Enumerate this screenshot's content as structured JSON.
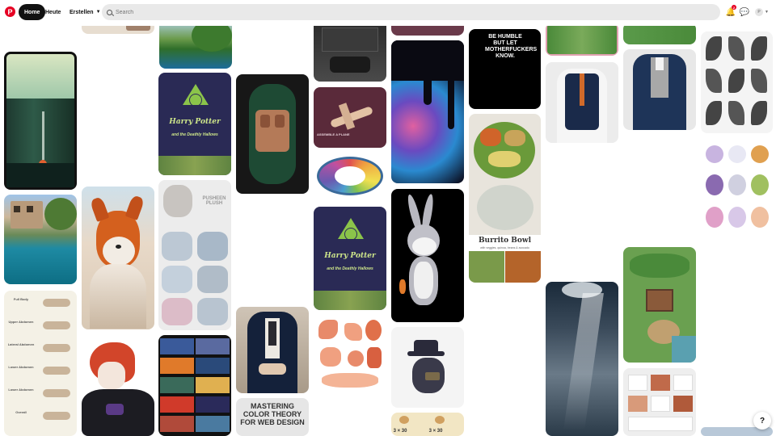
{
  "nav": {
    "logo": "P",
    "home": "Home",
    "today": "Heute",
    "create": "Erstellen"
  },
  "search": {
    "placeholder": "Search"
  },
  "header": {
    "notification_count": "2",
    "avatar_letter": "P"
  },
  "pins": {
    "hp_title_1": "Harry Potter",
    "hp_sub_1": "and the Deathly Hallows",
    "hp_title_2": "Harry Potter",
    "hp_sub_2": "and the Deathly Hallows",
    "pusheen": "PUSHEEN PLUSH",
    "behumble": "BE HUMBLE BUT LET MOTHERFUCKERS KNOW.",
    "burrito_title": "Burrito Bowl",
    "burrito_sub": "with veggies, quinoa, beans & avocado",
    "color_theory": "MASTERING COLOR THEORY FOR WEB DESIGN",
    "plane_label": "ASSEMBLE A PLANE",
    "exercises": [
      "Full Body",
      "Upper Abdomen",
      "Lateral Abdomen",
      "Lower Abdomen",
      "Lower Abdomen",
      "Overall"
    ],
    "reps_1": "3 × 30",
    "reps_2": "3 × 30"
  },
  "help": "?"
}
